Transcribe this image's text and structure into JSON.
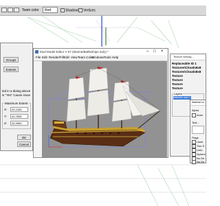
{
  "toolbar": {
    "team_color_label": "Team color",
    "team_color_value": "Red",
    "shadows_label": "Shadows",
    "vertices_label": "Vertices"
  },
  "left_dialog": {
    "groups_button": "Groups",
    "extents_button": "Extents",
    "info_line1": "ied in a dialog above",
    "info_line2": "is \"Yes\" Cause issue",
    "group_title": "Maximum Extent",
    "x_label": "X:",
    "x_value": "24.1344",
    "y_label": "Y:",
    "y_value": "42.7605",
    "z_label": "Z:",
    "z_value": "32.9999",
    "ok_button": "OK",
    "cancel_button": "Cancel"
  },
  "editor": {
    "title": "Mod Model Editor V 57 (Marine/Battleships.mdx) *",
    "menu": [
      "File",
      "Edit",
      "Render/Fill",
      "Edit",
      "View",
      "Team Color",
      "Windows",
      "Tools",
      "Help"
    ]
  },
  "texture_window": {
    "title": "Texture Manag...",
    "lines": [
      "Replaceable ID 1",
      "Textures\\Clouds8x8",
      "Textures\\Clouds8x8",
      "Texture",
      "Texture",
      "Texture",
      "Texture"
    ],
    "layers_label": "Layers",
    "selected_layer": "Material Layer 1"
  },
  "material_window": {
    "title": "Material La...",
    "alpha_label": "Alpha",
    "animated_label": "Anim",
    "texture_label": "Text...",
    "flags_label": "Flags",
    "flag_items": [
      "Unsh",
      "Two S",
      "Unfo",
      "Sphere",
      "No De",
      "No De"
    ]
  },
  "colors": {
    "viewport_bg": "#929292",
    "selected_blue": "#3c7ad8",
    "grid_green": "#3a7a3a"
  }
}
